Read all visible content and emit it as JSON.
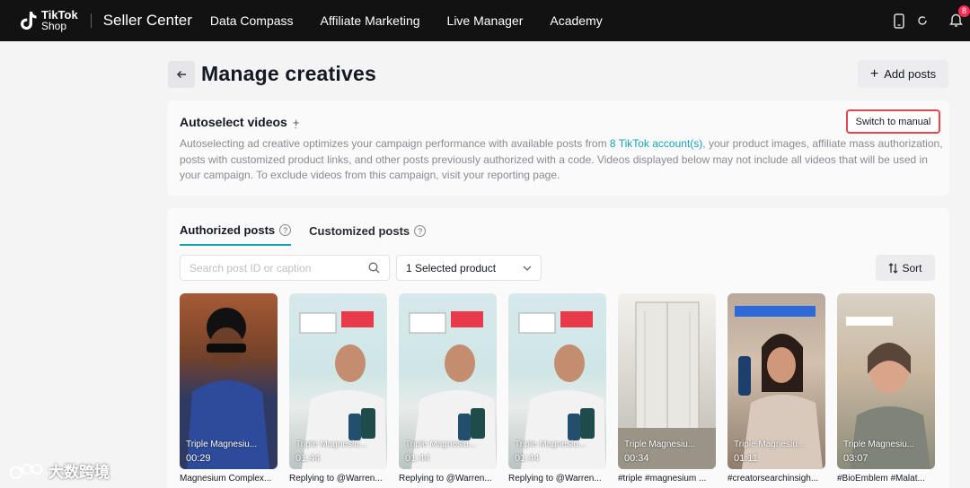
{
  "topbar": {
    "logo_line1": "TikTok",
    "logo_line2": "Shop",
    "brand": "Seller Center",
    "nav": [
      "Data Compass",
      "Affiliate Marketing",
      "Live Manager",
      "Academy"
    ],
    "notification_count": "8",
    "icons": [
      "phone-icon",
      "refresh-icon",
      "bell-icon"
    ]
  },
  "header": {
    "title": "Manage creatives",
    "add_label": "Add posts"
  },
  "autoselect": {
    "title": "Autoselect videos",
    "switch_label": "Switch to manual",
    "desc_part1": "Autoselecting ad creative optimizes your campaign performance with available posts from ",
    "desc_link": "8 TikTok account(s)",
    "desc_part2": ", your product images, affiliate mass authorization, posts with customized product links, and other posts previously authorized with a code. Videos displayed below may not include all videos that will be used in your campaign. To exclude videos from this campaign, visit your reporting page."
  },
  "posts": {
    "tabs": [
      "Authorized posts",
      "Customized posts"
    ],
    "search_placeholder": "Search post ID or caption",
    "product_select": "1 Selected product",
    "sort_label": "Sort",
    "videos": [
      {
        "title": "Triple Magnesiu...",
        "duration": "00:29",
        "caption": "Magnesium Complex..."
      },
      {
        "title": "Triple Magnesiu...",
        "duration": "01:44",
        "caption": "Replying to @Warren..."
      },
      {
        "title": "Triple Magnesiu...",
        "duration": "01:44",
        "caption": "Replying to @Warren..."
      },
      {
        "title": "Triple Magnesiu...",
        "duration": "01:44",
        "caption": "Replying to @Warren..."
      },
      {
        "title": "Triple Magnesiu...",
        "duration": "00:34",
        "caption": "#triple #magnesium ..."
      },
      {
        "title": "Triple Magnesiu...",
        "duration": "01:11",
        "caption": "#creatorsearchinsigh..."
      },
      {
        "title": "Triple Magnesiu...",
        "duration": "03:07",
        "caption": "#BioEmblem #Malat..."
      }
    ]
  },
  "watermark": "大数跨境",
  "colors": {
    "accent": "#16a3b5",
    "highlight_border": "#e0474f",
    "topbar": "#121212"
  }
}
